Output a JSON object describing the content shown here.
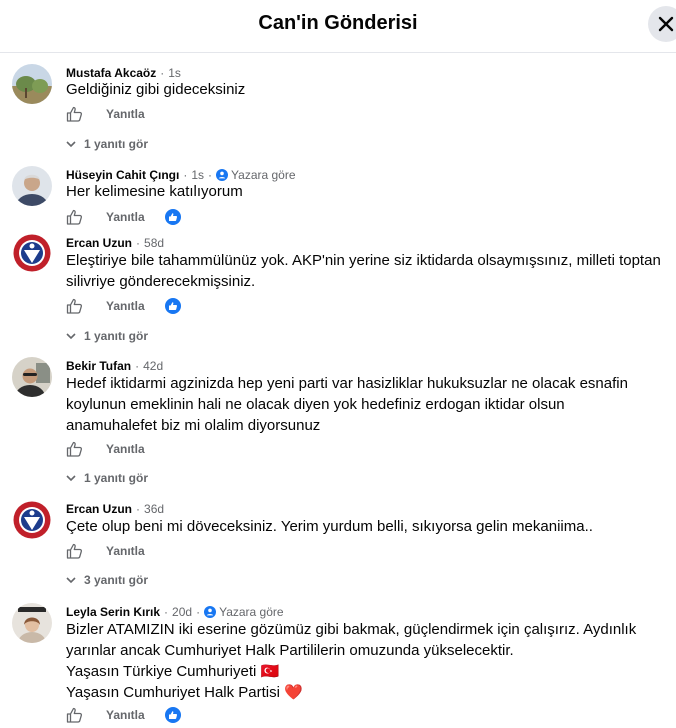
{
  "header": {
    "title": "Can'in Gönderisi"
  },
  "labels": {
    "reply": "Yanıtla"
  },
  "comments": [
    {
      "author": "Mustafa Akcaöz",
      "time": "1s",
      "text_lines": [
        "Geldiğiniz gibi gideceksiniz"
      ],
      "view_replies": "1 yanıtı gör",
      "has_reaction": false
    },
    {
      "author": "Hüseyin Cahit Çıngı",
      "time": "1s",
      "badge": "Yazara göre",
      "text_lines": [
        "Her kelimesine katılıyorum"
      ],
      "has_reaction": true
    },
    {
      "author": "Ercan Uzun",
      "time": "58d",
      "text_lines": [
        "Eleştiriye bile tahammülünüz yok. AKP'nin yerine siz iktidarda olsaymışsınız, milleti toptan",
        "silivriye gönderecekmişsiniz."
      ],
      "view_replies": "1 yanıtı gör",
      "has_reaction": true
    },
    {
      "author": "Bekir Tufan",
      "time": "42d",
      "text_lines": [
        "Hedef iktidarmi agzinizda hep yeni parti var hasizliklar hukuksuzlar ne olacak esnafin",
        "koylunun emeklinin hali ne olacak diyen yok hedefiniz erdogan iktidar olsun",
        "anamuhalefet biz mi olalim diyorsunuz"
      ],
      "view_replies": "1 yanıtı gör",
      "has_reaction": false
    },
    {
      "author": "Ercan Uzun",
      "time": "36d",
      "text_lines": [
        "Çete olup beni mi döveceksiniz. Yerim yurdum belli, sıkıyorsa gelin mekaniima.."
      ],
      "view_replies": "3 yanıtı gör",
      "has_reaction": false
    },
    {
      "author": "Leyla Serin Kırık",
      "time": "20d",
      "badge": "Yazara göre",
      "text_lines": [
        "Bizler ATAMIZIN iki eserine gözümüz gibi bakmak, güçlendirmek için çalışırız. Aydınlık",
        "yarınlar ancak Cumhuriyet Halk Partililerin omuzunda yükselecektir.",
        "Yaşasın Türkiye Cumhuriyeti 🇹🇷",
        "Yaşasın Cumhuriyet Halk Partisi ❤️"
      ],
      "has_reaction": true
    }
  ]
}
